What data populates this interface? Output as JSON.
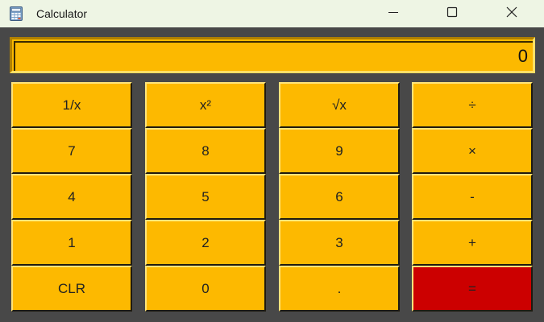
{
  "window": {
    "title": "Calculator",
    "icon": "calculator-icon",
    "controls": {
      "minimize": "minimize-icon",
      "maximize": "maximize-icon",
      "close": "close-icon"
    }
  },
  "display": {
    "value": "0"
  },
  "keys": {
    "reciprocal": "1/x",
    "square": "x²",
    "sqrt": "√x",
    "divide": "÷",
    "seven": "7",
    "eight": "8",
    "nine": "9",
    "multiply": "×",
    "four": "4",
    "five": "5",
    "six": "6",
    "minus": "-",
    "one": "1",
    "two": "2",
    "three": "3",
    "plus": "+",
    "clear": "CLR",
    "zero": "0",
    "decimal": ".",
    "equals": "="
  },
  "colors": {
    "key_background": "#fdb900",
    "equals_background": "#cc0000",
    "client_background": "#484848",
    "titlebar_background": "#eef5e4"
  }
}
